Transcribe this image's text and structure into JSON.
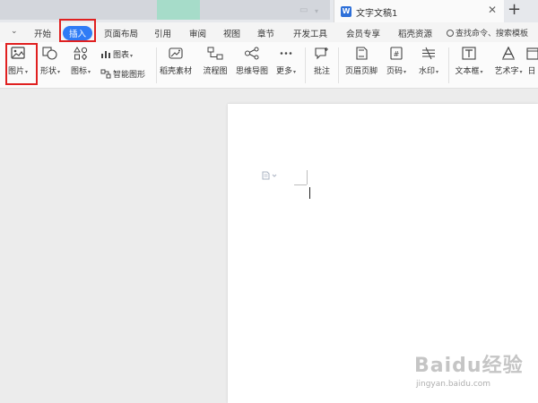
{
  "tab": {
    "title": "文字文稿1",
    "close_label": "✕",
    "new_label": "+"
  },
  "menu": {
    "items": [
      "开始",
      "插入",
      "页面布局",
      "引用",
      "审阅",
      "视图",
      "章节",
      "开发工具",
      "会员专享",
      "稻壳资源"
    ],
    "active": "插入",
    "search_placeholder": "查找命令、搜索模板"
  },
  "ribbon": {
    "picture": "图片",
    "shape": "形状",
    "icon": "图标",
    "chart": "图表",
    "smart_shape": "智能图形",
    "docer_material": "稻壳素材",
    "flowchart": "流程图",
    "mindmap": "思维导图",
    "more": "更多",
    "comment": "批注",
    "header_footer": "页眉页脚",
    "page_number": "页码",
    "watermark": "水印",
    "textbox": "文本框",
    "wordart": "艺术字",
    "date_partial": "日"
  },
  "watermark_overlay": {
    "main": "Baidu经验",
    "sub": "jingyan.baidu.com"
  },
  "colors": {
    "accent": "#2f7cf6",
    "highlight": "#e02020",
    "word_icon": "#2d6fd8"
  }
}
